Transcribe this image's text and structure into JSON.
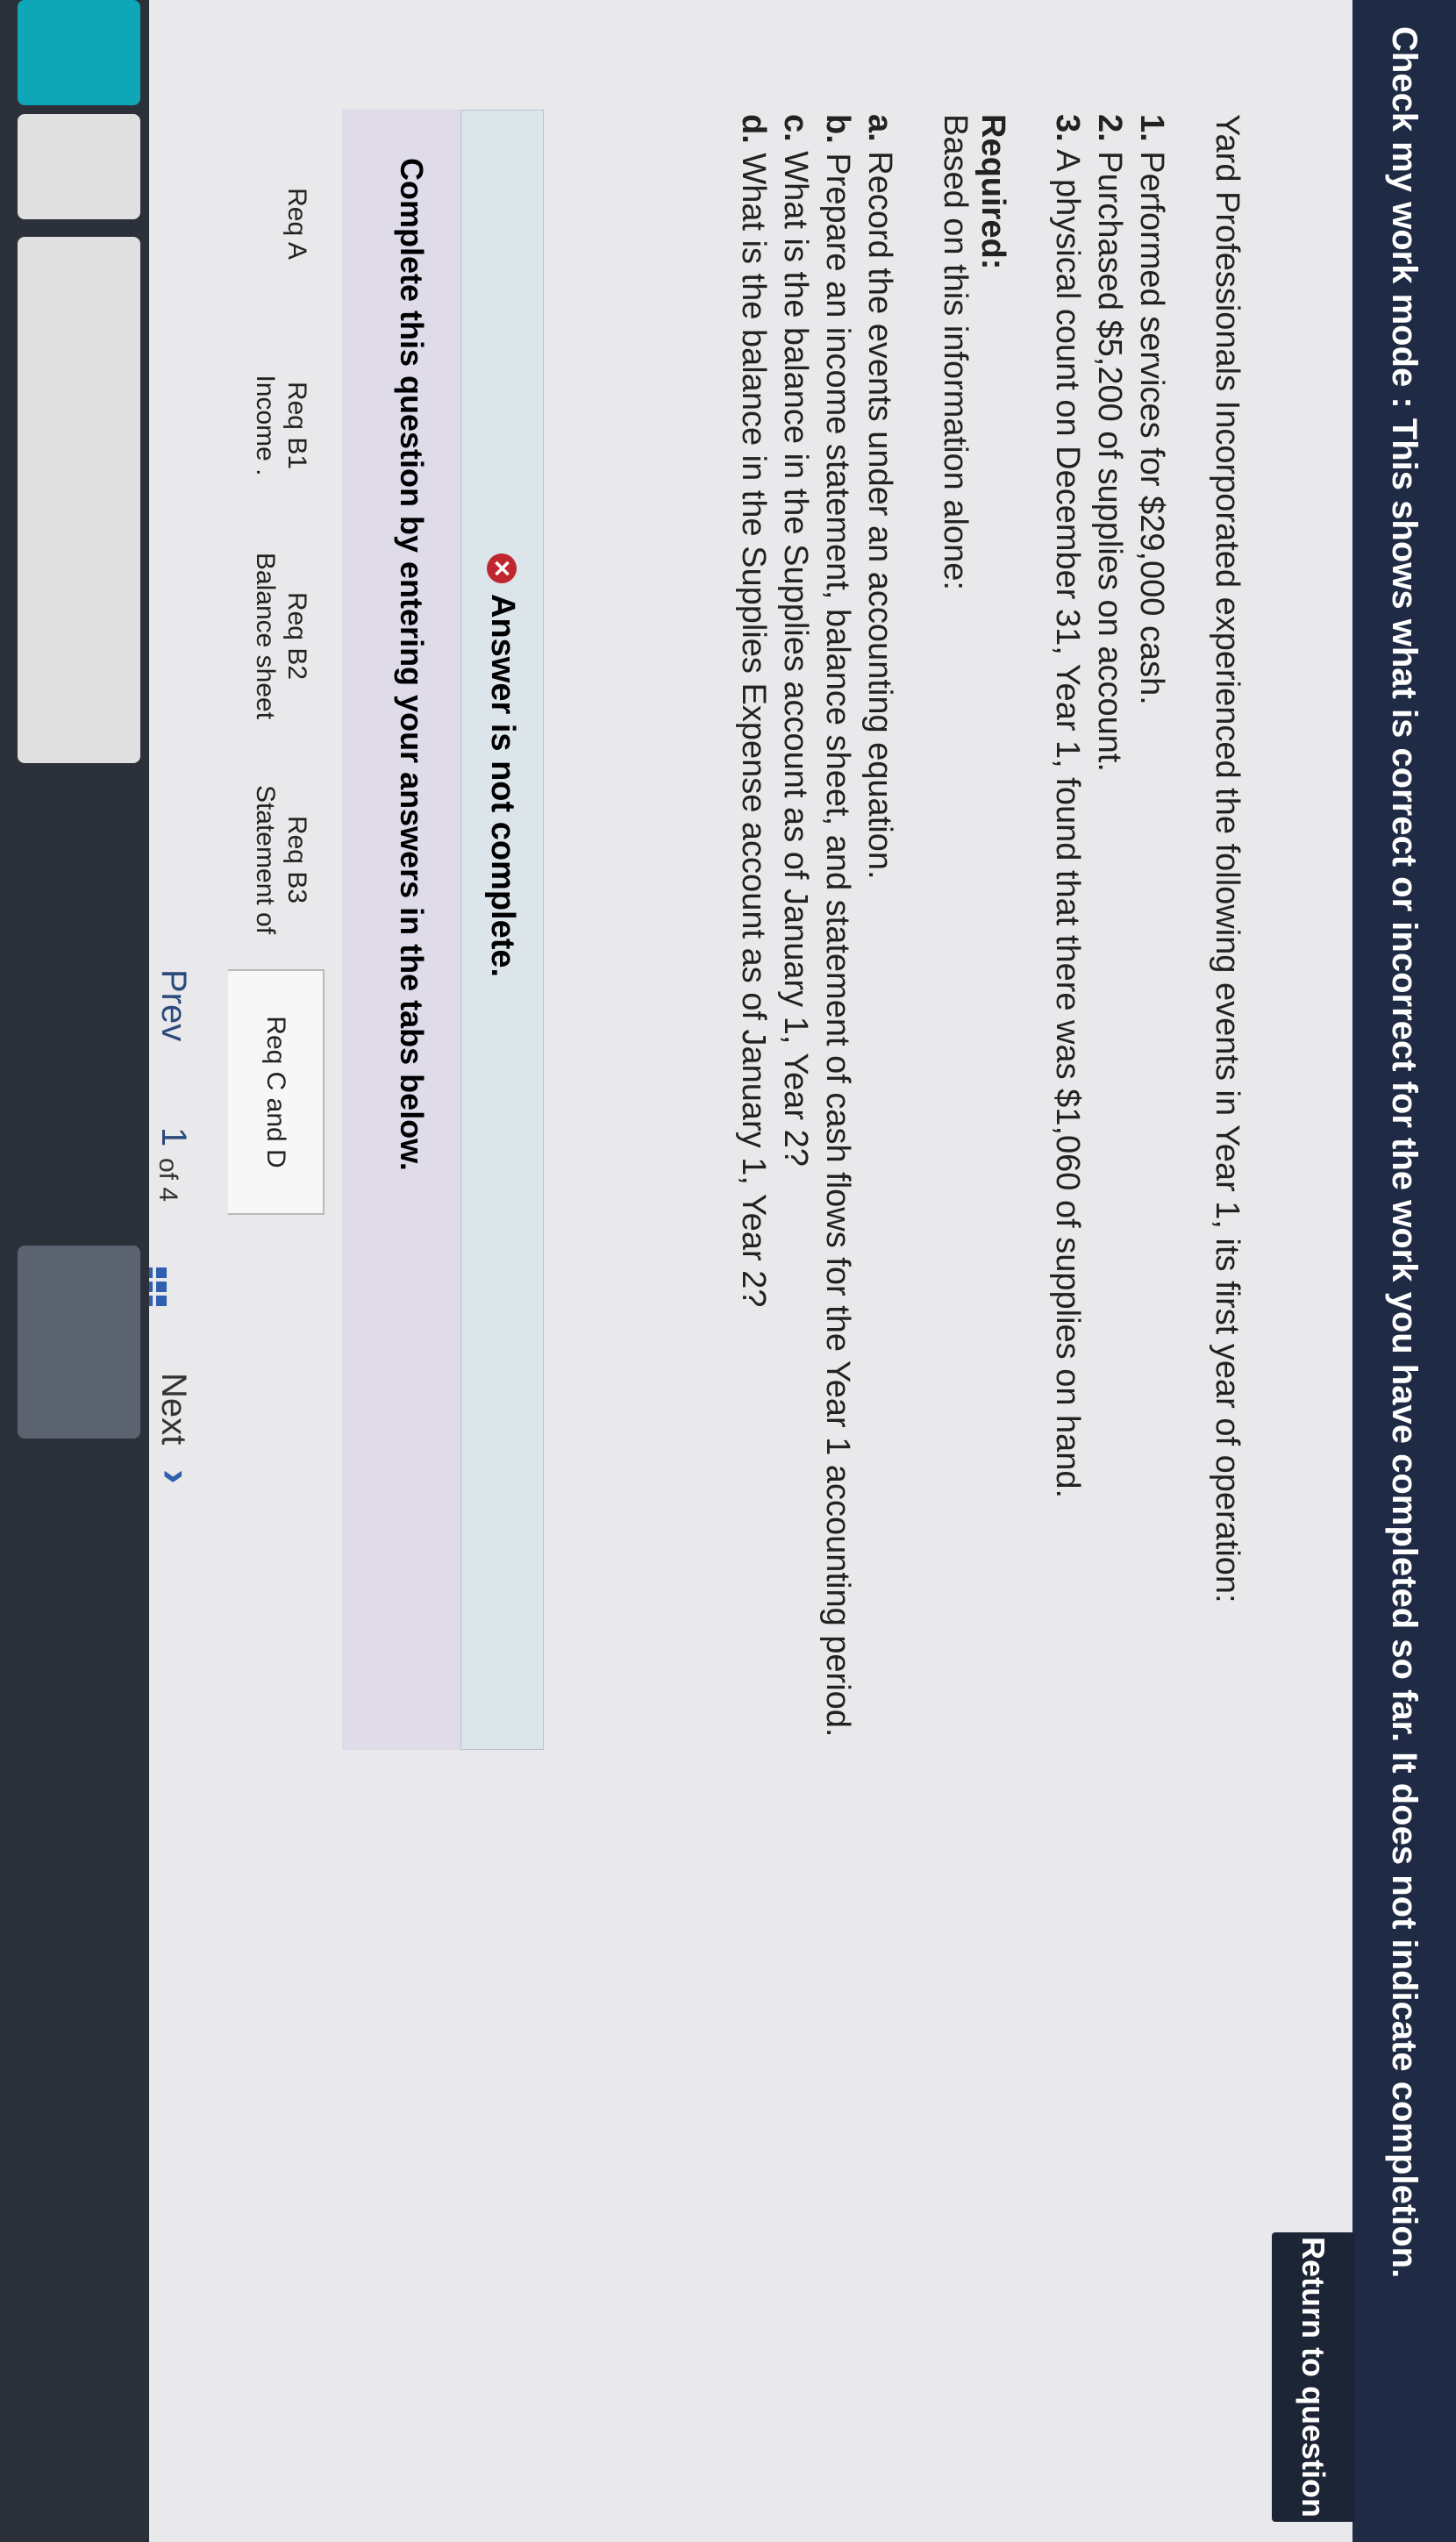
{
  "header": {
    "mode_text": "Check my work mode : This shows what is correct or incorrect for the work you have completed so far. It does not indicate completion.",
    "return_label": "Return to question"
  },
  "problem": {
    "intro": "Yard Professionals Incorporated experienced the following events in Year 1, its first year of operation:",
    "events": [
      {
        "num": "1.",
        "text": "Performed services for $29,000 cash."
      },
      {
        "num": "2.",
        "text": "Purchased $5,200 of supplies on account."
      },
      {
        "num": "3.",
        "text": "A physical count on December 31, Year 1, found that there was $1,060 of supplies on hand."
      }
    ],
    "required_heading": "Required:",
    "required_sub": "Based on this information alone:",
    "requirements": [
      {
        "letter": "a.",
        "text": "Record the events under an accounting equation."
      },
      {
        "letter": "b.",
        "text": "Prepare an income statement, balance sheet, and statement of cash flows for the Year 1 accounting period."
      },
      {
        "letter": "c.",
        "text": "What is the balance in the Supplies account as of January 1, Year 2?"
      },
      {
        "letter": "d.",
        "text": "What is the balance in the Supplies Expense account as of January 1, Year 2?"
      }
    ]
  },
  "status": {
    "answer_text": "Answer is not complete.",
    "complete_text": "Complete this question by entering your answers in the tabs below."
  },
  "tabs": [
    {
      "l1": "Req A",
      "l2": ""
    },
    {
      "l1": "Req B1",
      "l2": "Income ."
    },
    {
      "l1": "Req B2",
      "l2": "Balance sheet"
    },
    {
      "l1": "Req B3",
      "l2": "Statement of"
    },
    {
      "l1": "Req C and D",
      "l2": ""
    }
  ],
  "pager": {
    "prev": "Prev",
    "current": "1",
    "of_label": "of 4",
    "next": "Next"
  },
  "colors": {
    "banner": "#1f2a44",
    "answer_box": "#dbe5ea",
    "band": "#dfdbe9",
    "error": "#c0262d",
    "link": "#2f5fae"
  },
  "icons": [
    "close-icon",
    "grid-icon",
    "chevron-right-icon"
  ]
}
